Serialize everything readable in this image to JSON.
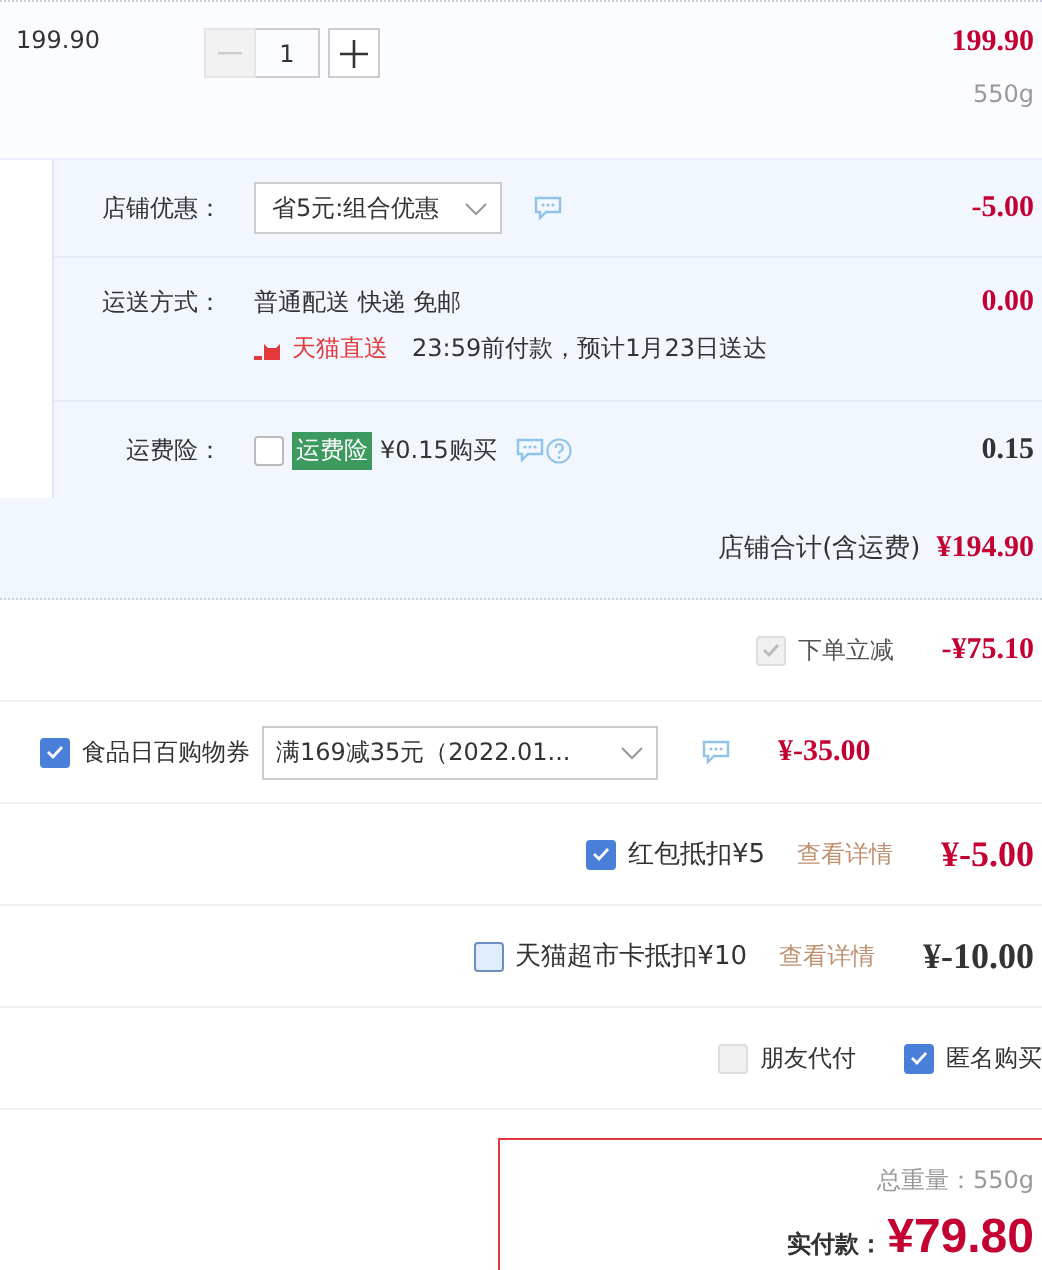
{
  "item": {
    "unit_price": "199.90",
    "quantity": "1",
    "decrement_disabled": true,
    "subtotal": "199.90",
    "weight": "550g"
  },
  "store": {
    "discount": {
      "label": "店铺优惠：",
      "selection": "省5元:组合优惠",
      "amount": "-5.00"
    },
    "shipping": {
      "label": "运送方式：",
      "method": "普通配送 快递 免邮",
      "brand": "天猫直送",
      "eta": "23:59前付款，预计1月23日送达",
      "amount": "0.00"
    },
    "insurance": {
      "label": "运费险：",
      "checked": false,
      "tag": "运费险",
      "price": "¥0.15购买",
      "amount": "0.15"
    },
    "total": {
      "label": "店铺合计(含运费)",
      "amount": "¥194.90"
    }
  },
  "adjustments": [
    {
      "kind": "instant",
      "label": "下单立减",
      "checked": true,
      "disabled": true,
      "amount": "-¥75.10"
    },
    {
      "kind": "coupon",
      "label": "食品日百购物券",
      "checked": true,
      "selection": "满169减35元（2022.01...",
      "amount": "¥-35.00"
    },
    {
      "kind": "deduction",
      "label": "红包抵扣¥5",
      "checked": true,
      "link": "查看详情",
      "amount": "¥-5.00"
    },
    {
      "kind": "deduction",
      "label": "天猫超市卡抵扣¥10",
      "checked": false,
      "link": "查看详情",
      "amount": "¥-10.00"
    }
  ],
  "options": [
    {
      "label": "朋友代付",
      "checked": false
    },
    {
      "label": "匿名购买",
      "checked": true
    }
  ],
  "summary": {
    "weight": "总重量：550g",
    "pay_label": "实付款：",
    "pay_amount": "¥79.80"
  }
}
